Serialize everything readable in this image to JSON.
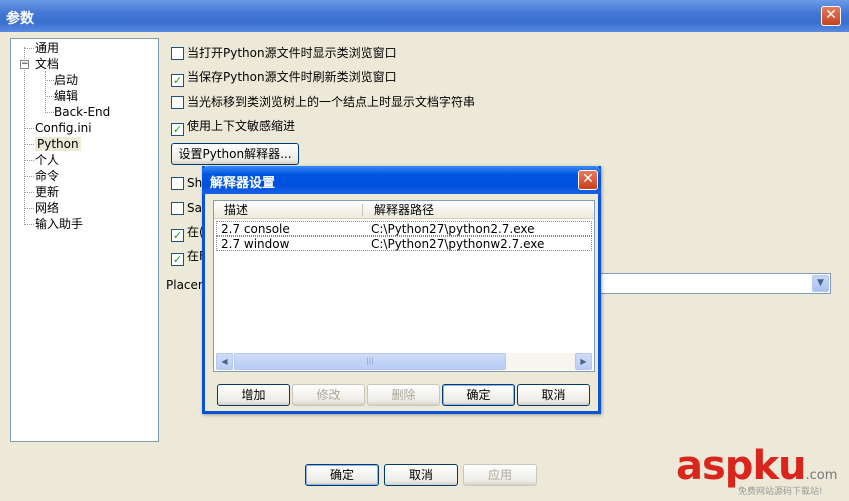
{
  "window": {
    "title": "参数",
    "close": "✕"
  },
  "tree": {
    "items": [
      {
        "label": "通用"
      },
      {
        "label": "文档",
        "expander": "−"
      },
      {
        "label": "启动"
      },
      {
        "label": "编辑"
      },
      {
        "label": "Back-End"
      },
      {
        "label": "Config.ini"
      },
      {
        "label": "Python"
      },
      {
        "label": "个人"
      },
      {
        "label": "命令"
      },
      {
        "label": "更新"
      },
      {
        "label": "网络"
      },
      {
        "label": "输入助手"
      }
    ]
  },
  "options": [
    {
      "label": "当打开Python源文件时显示类浏览窗口",
      "checked": false
    },
    {
      "label": "当保存Python源文件时刷新类浏览窗口",
      "checked": true
    },
    {
      "label": "当光标移到类浏览树上的一个结点上时显示文档字符串",
      "checked": false
    },
    {
      "label": "使用上下文敏感缩进",
      "checked": true
    }
  ],
  "set_interpreter_button": "设置Python解释器...",
  "hidden_options": [
    {
      "label": "Sh",
      "checked": false
    },
    {
      "label": "Sav",
      "checked": false
    },
    {
      "label": "在(",
      "checked": true
    },
    {
      "label": "在F",
      "checked": true
    }
  ],
  "placement_label": "Placem",
  "combo_arrow": "▼",
  "dialog": {
    "title": "解释器设置",
    "close": "✕",
    "columns": {
      "desc": "描述",
      "path": "解释器路径"
    },
    "rows": [
      {
        "desc": "2.7 console",
        "path": "C:\\Python27\\python2.7.exe"
      },
      {
        "desc": "2.7 window",
        "path": "C:\\Python27\\pythonw2.7.exe"
      }
    ],
    "scroll_left": "◀",
    "scroll_right": "▶",
    "thumb_grip": "|||",
    "buttons": {
      "add": "增加",
      "modify": "修改",
      "delete": "删除",
      "ok": "确定",
      "cancel": "取消"
    }
  },
  "footer": {
    "ok": "确定",
    "cancel": "取消",
    "apply": "应用"
  },
  "watermark": {
    "brand_a": "asp",
    "brand_b": "ku",
    "domain": ".com",
    "subtitle": "免费网站源码下载站!"
  }
}
